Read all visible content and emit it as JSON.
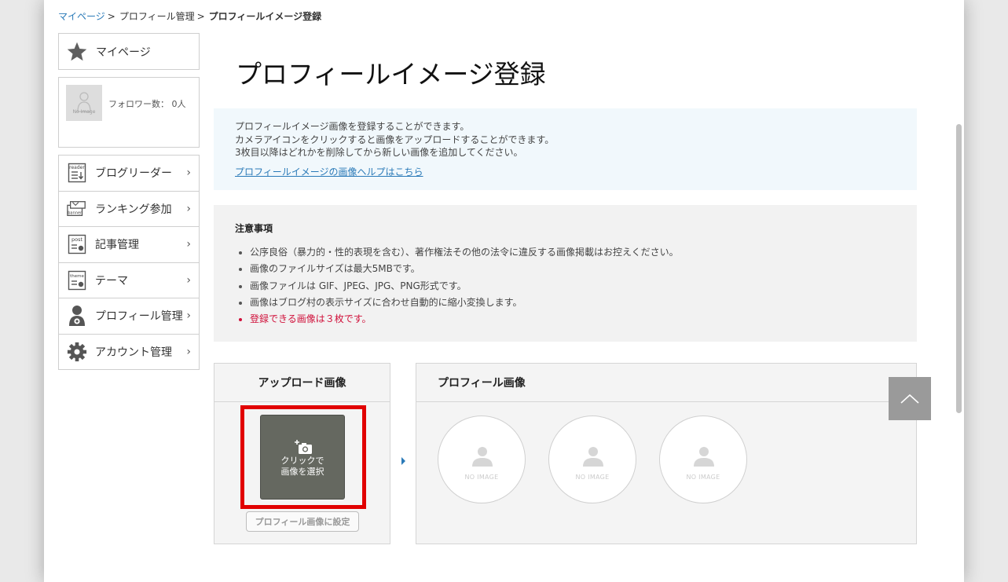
{
  "breadcrumb": {
    "mypage": "マイページ",
    "sep1": ">",
    "profile": "プロフィール管理",
    "sep2": ">",
    "current": "プロフィールイメージ登録"
  },
  "sidebar": {
    "mypage_label": "マイページ",
    "avatar_text": "No Image",
    "followers": "フォロワー数： 0人",
    "menu": [
      {
        "label": "ブログリーダー",
        "icon": "reader-icon",
        "icon_text": "reader"
      },
      {
        "label": "ランキング参加",
        "icon": "banner-icon",
        "icon_text": "banner"
      },
      {
        "label": "記事管理",
        "icon": "post-icon",
        "icon_text": "post"
      },
      {
        "label": "テーマ",
        "icon": "theme-icon",
        "icon_text": "theme"
      },
      {
        "label": "プロフィール管理",
        "icon": "profile-gear-icon"
      },
      {
        "label": "アカウント管理",
        "icon": "gear-icon"
      }
    ],
    "chevron": "›"
  },
  "main": {
    "title": "プロフィールイメージ登録",
    "info": {
      "line1": "プロフィールイメージ画像を登録することができます。",
      "line2": "カメラアイコンをクリックすると画像をアップロードすることができます。",
      "line3": "3枚目以降はどれかを削除してから新しい画像を追加してください。",
      "help_link": "プロフィールイメージの画像ヘルプはこちら"
    },
    "notice": {
      "title": "注意事項",
      "items": [
        "公序良俗（暴力的・性的表現を含む）、著作権法その他の法令に違反する画像掲載はお控えください。",
        "画像のファイルサイズは最大5MBです。",
        "画像ファイルは GIF、JPEG、JPG、PNG形式です。",
        "画像はブログ村の表示サイズに合わせ自動的に縮小変換します。"
      ],
      "warning": "登録できる画像は３枚です。"
    },
    "upload": {
      "heading": "アップロード画像",
      "button_line1": "クリックで",
      "button_line2": "画像を選択",
      "set_button": "プロフィール画像に設定"
    },
    "profile_images": {
      "heading": "プロフィール画像",
      "slots": [
        "NO IMAGE",
        "NO IMAGE",
        "NO IMAGE"
      ]
    }
  },
  "colors": {
    "link": "#2a7ab8",
    "highlight": "#e10000",
    "warning": "#d0103a",
    "upload_button": "#656860"
  }
}
